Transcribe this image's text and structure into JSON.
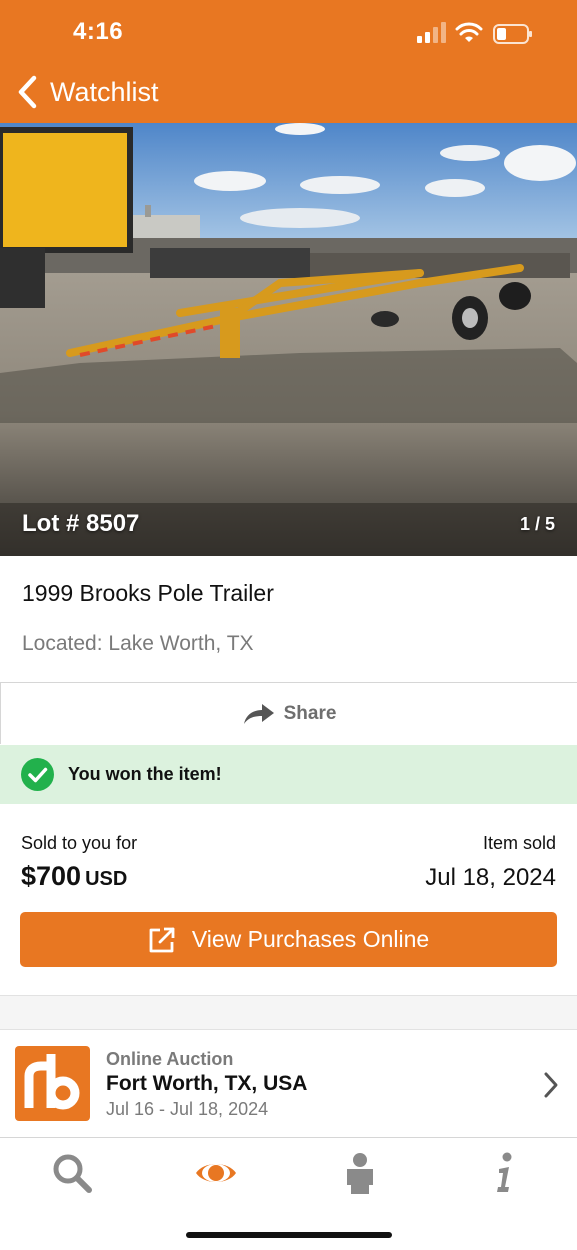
{
  "status_bar": {
    "time": "4:16"
  },
  "header": {
    "back_label": "Watchlist"
  },
  "photo": {
    "lot_label": "Lot # 8507",
    "counter": "1 / 5"
  },
  "item": {
    "title": "1999 Brooks Pole Trailer",
    "location": "Located: Lake Worth, TX"
  },
  "share": {
    "label": "Share"
  },
  "win_banner": {
    "text": "You won the item!"
  },
  "sale": {
    "sold_label": "Sold to you for",
    "price": "$700",
    "currency": "USD",
    "item_sold_label": "Item sold",
    "item_sold_date": "Jul 18, 2024"
  },
  "purchase_button": {
    "label": "View Purchases Online"
  },
  "auction": {
    "logo_text": "rb",
    "type": "Online Auction",
    "location": "Fort Worth, TX, USA",
    "dates": "Jul 16 - Jul 18, 2024"
  },
  "tabs": [
    {
      "name": "search-icon",
      "active": false
    },
    {
      "name": "eye-icon",
      "active": true
    },
    {
      "name": "person-icon",
      "active": false
    },
    {
      "name": "info-icon",
      "active": false
    }
  ],
  "colors": {
    "brand": "#e87722",
    "success": "#22b14c",
    "success_bg": "#dcf2de",
    "muted": "#7a7a7a"
  }
}
